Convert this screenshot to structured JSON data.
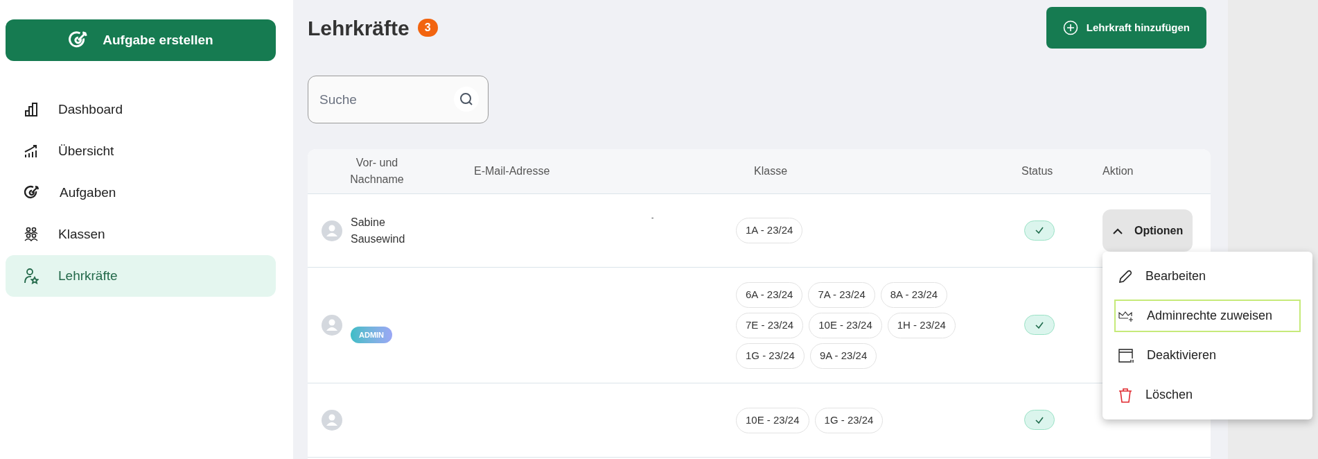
{
  "sidebar": {
    "create_button": "Aufgabe erstellen",
    "items": [
      {
        "label": "Dashboard",
        "kind": "bars",
        "selected": false
      },
      {
        "label": "Übersicht",
        "kind": "trend",
        "selected": false
      },
      {
        "label": "Aufgaben",
        "kind": "target",
        "selected": false
      },
      {
        "label": "Klassen",
        "kind": "group",
        "selected": false
      },
      {
        "label": "Lehrkräfte",
        "kind": "teacher",
        "selected": true
      }
    ]
  },
  "header": {
    "title": "Lehrkräfte",
    "count": "3",
    "add_button": "Lehrkraft hinzufügen"
  },
  "search": {
    "placeholder": "Suche"
  },
  "table": {
    "columns": [
      "Vor- und Nachname",
      "E-Mail-Adresse",
      "Klasse",
      "Status",
      "Aktion"
    ],
    "rows": [
      {
        "name": "Sabine Sausewind",
        "admin": false,
        "email": "-",
        "classes": [
          "1A - 23/24"
        ],
        "active": true,
        "action": "Optionen",
        "expanded": true
      },
      {
        "admin": true,
        "admin_label": "ADMIN",
        "classes": [
          "6A - 23/24",
          "7A - 23/24",
          "8A - 23/24",
          "7E - 23/24",
          "10E - 23/24",
          "1H - 23/24",
          "1G - 23/24",
          "9A - 23/24"
        ],
        "active": true
      },
      {
        "admin": false,
        "classes": [
          "10E - 23/24",
          "1G - 23/24"
        ],
        "active": true
      }
    ]
  },
  "menu": {
    "items": [
      {
        "label": "Bearbeiten",
        "kind": "edit",
        "selected": false
      },
      {
        "label": "Adminrechte zuweisen",
        "kind": "admin",
        "selected": true
      },
      {
        "label": "Deaktivieren",
        "kind": "deactivate",
        "selected": false
      },
      {
        "label": "Löschen",
        "kind": "delete",
        "selected": false
      }
    ]
  }
}
